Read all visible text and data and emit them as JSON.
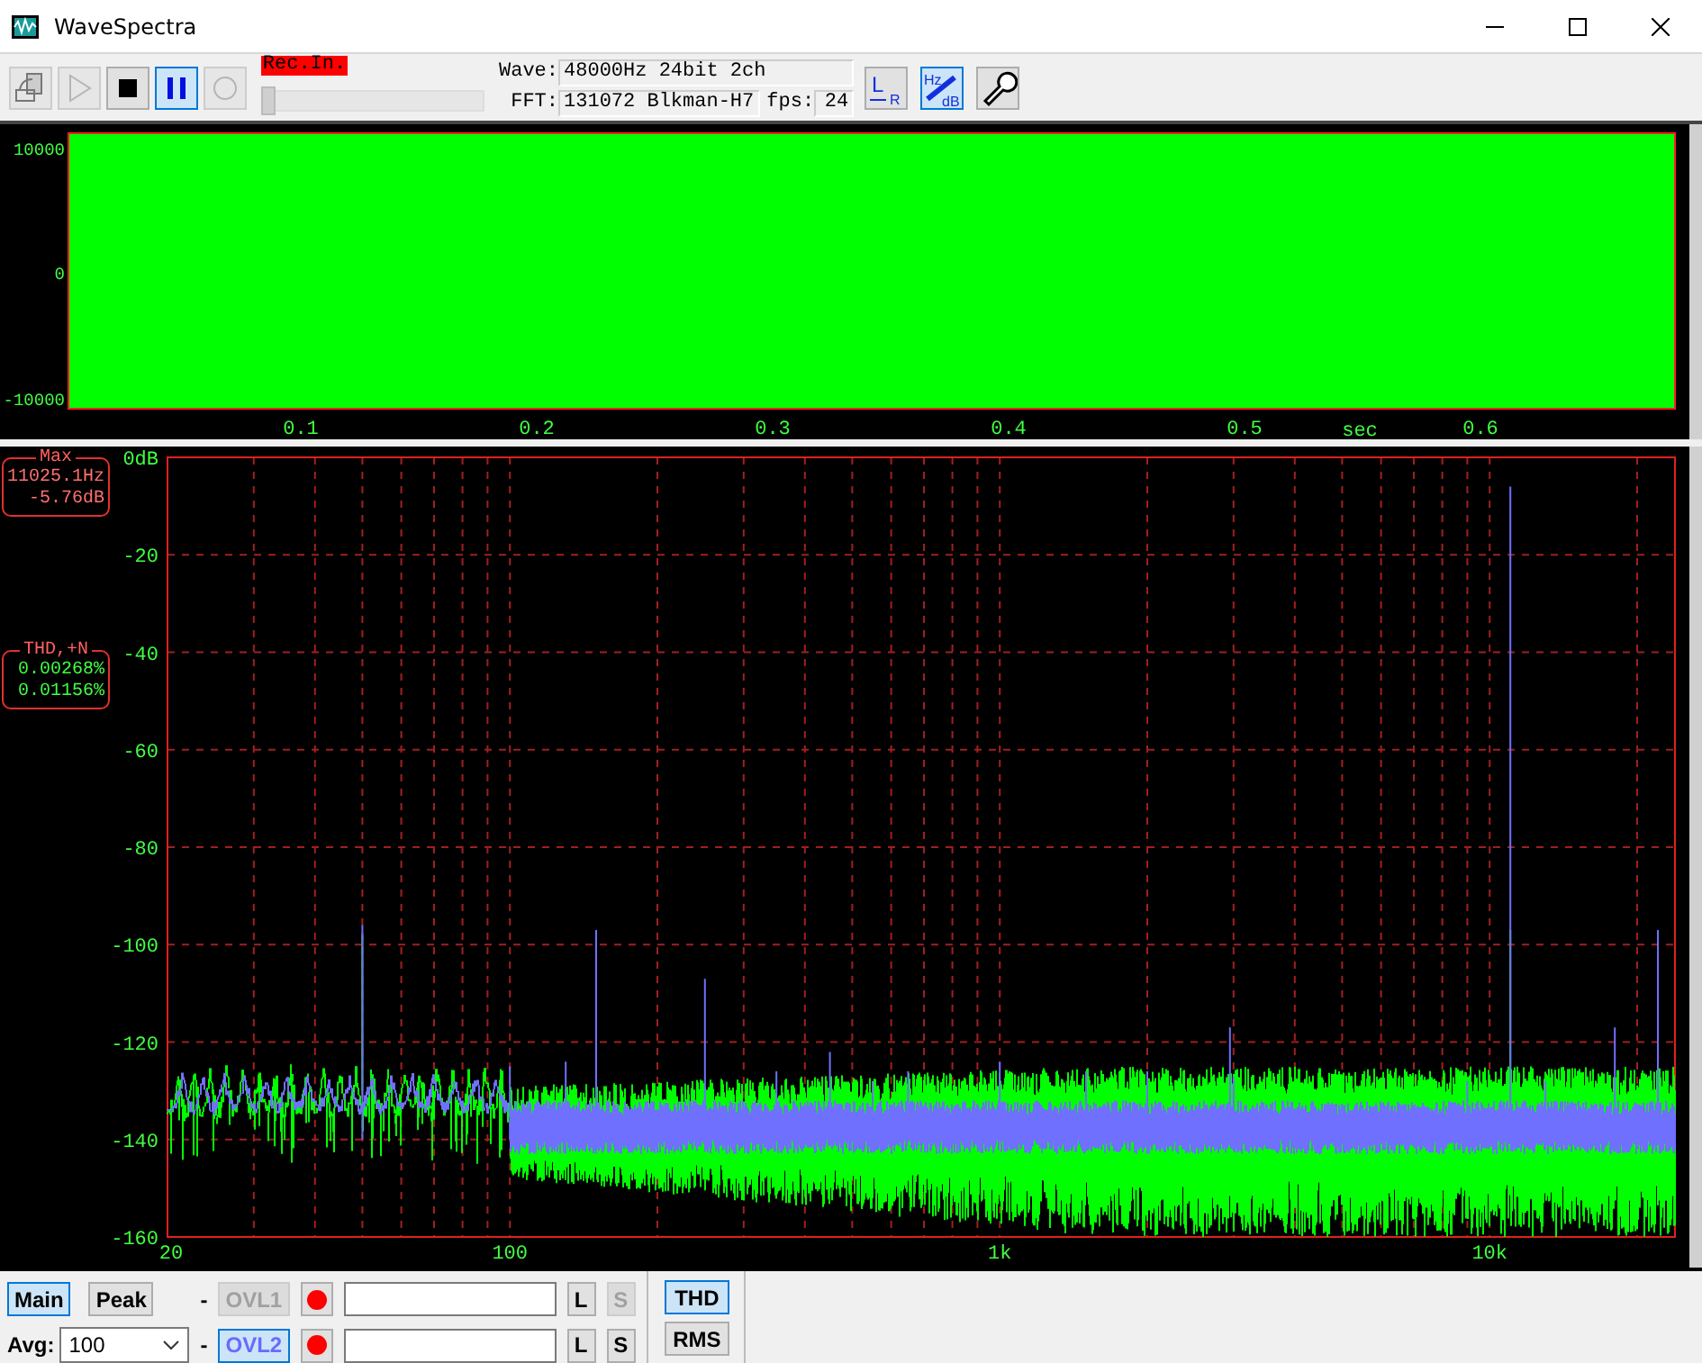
{
  "window": {
    "title": "WaveSpectra"
  },
  "toolbar": {
    "buttons": [
      {
        "kind": "export",
        "selected": false,
        "disabled": true
      },
      {
        "kind": "play",
        "selected": false,
        "disabled": true
      },
      {
        "kind": "stop",
        "selected": false,
        "disabled": false
      },
      {
        "kind": "pause",
        "selected": true,
        "disabled": false
      },
      {
        "kind": "record",
        "selected": false,
        "disabled": true
      }
    ],
    "rec_label": "Rec.In.",
    "slider": {
      "level": 0
    },
    "wave_label": "Wave:",
    "wave_value": "48000Hz 24bit 2ch",
    "fft_label": "FFT:",
    "fft_value": "131072 Blkman-H7",
    "fps_label": "fps:",
    "fps_value": "24",
    "tools": [
      {
        "kind": "channels",
        "selected": false,
        "texts": [
          "L",
          "R"
        ]
      },
      {
        "kind": "scale",
        "selected": true,
        "texts": [
          "Hz",
          "dB"
        ]
      },
      {
        "kind": "settings",
        "selected": false
      }
    ]
  },
  "waveform": {
    "y_ticks": [
      "10000",
      "0",
      "-10000"
    ],
    "x_ticks": [
      "0.1",
      "0.2",
      "0.3",
      "0.4",
      "0.5",
      "0.6"
    ],
    "x_unit": "sec"
  },
  "spectrum": {
    "y_ticks": [
      "0dB",
      "-20",
      "-40",
      "-60",
      "-80",
      "-100",
      "-120",
      "-140",
      "-160"
    ],
    "x_ticks": [
      "20",
      "100",
      "1k",
      "10k"
    ],
    "max_box": {
      "title": "Max",
      "lines": [
        "11025.1Hz",
        "-5.76dB"
      ]
    },
    "thd_box": {
      "title": "THD,+N",
      "lines": [
        "0.00268%",
        "0.01156%"
      ]
    }
  },
  "bottom_bar": {
    "main": {
      "label": "Main",
      "selected": true
    },
    "peak": {
      "label": "Peak",
      "selected": false
    },
    "avg_label": "Avg:",
    "avg_value": "100",
    "overlays": [
      {
        "dash": "-",
        "label": "OVL1",
        "selected": false,
        "disabled": true,
        "l_label": "L",
        "s_label": "S",
        "s_disabled": true
      },
      {
        "dash": "-",
        "label": "OVL2",
        "selected": true,
        "disabled": false,
        "l_label": "L",
        "s_label": "S",
        "s_disabled": false
      }
    ],
    "modes": [
      {
        "label": "THD",
        "selected": true
      },
      {
        "label": "RMS",
        "selected": false
      }
    ]
  }
}
